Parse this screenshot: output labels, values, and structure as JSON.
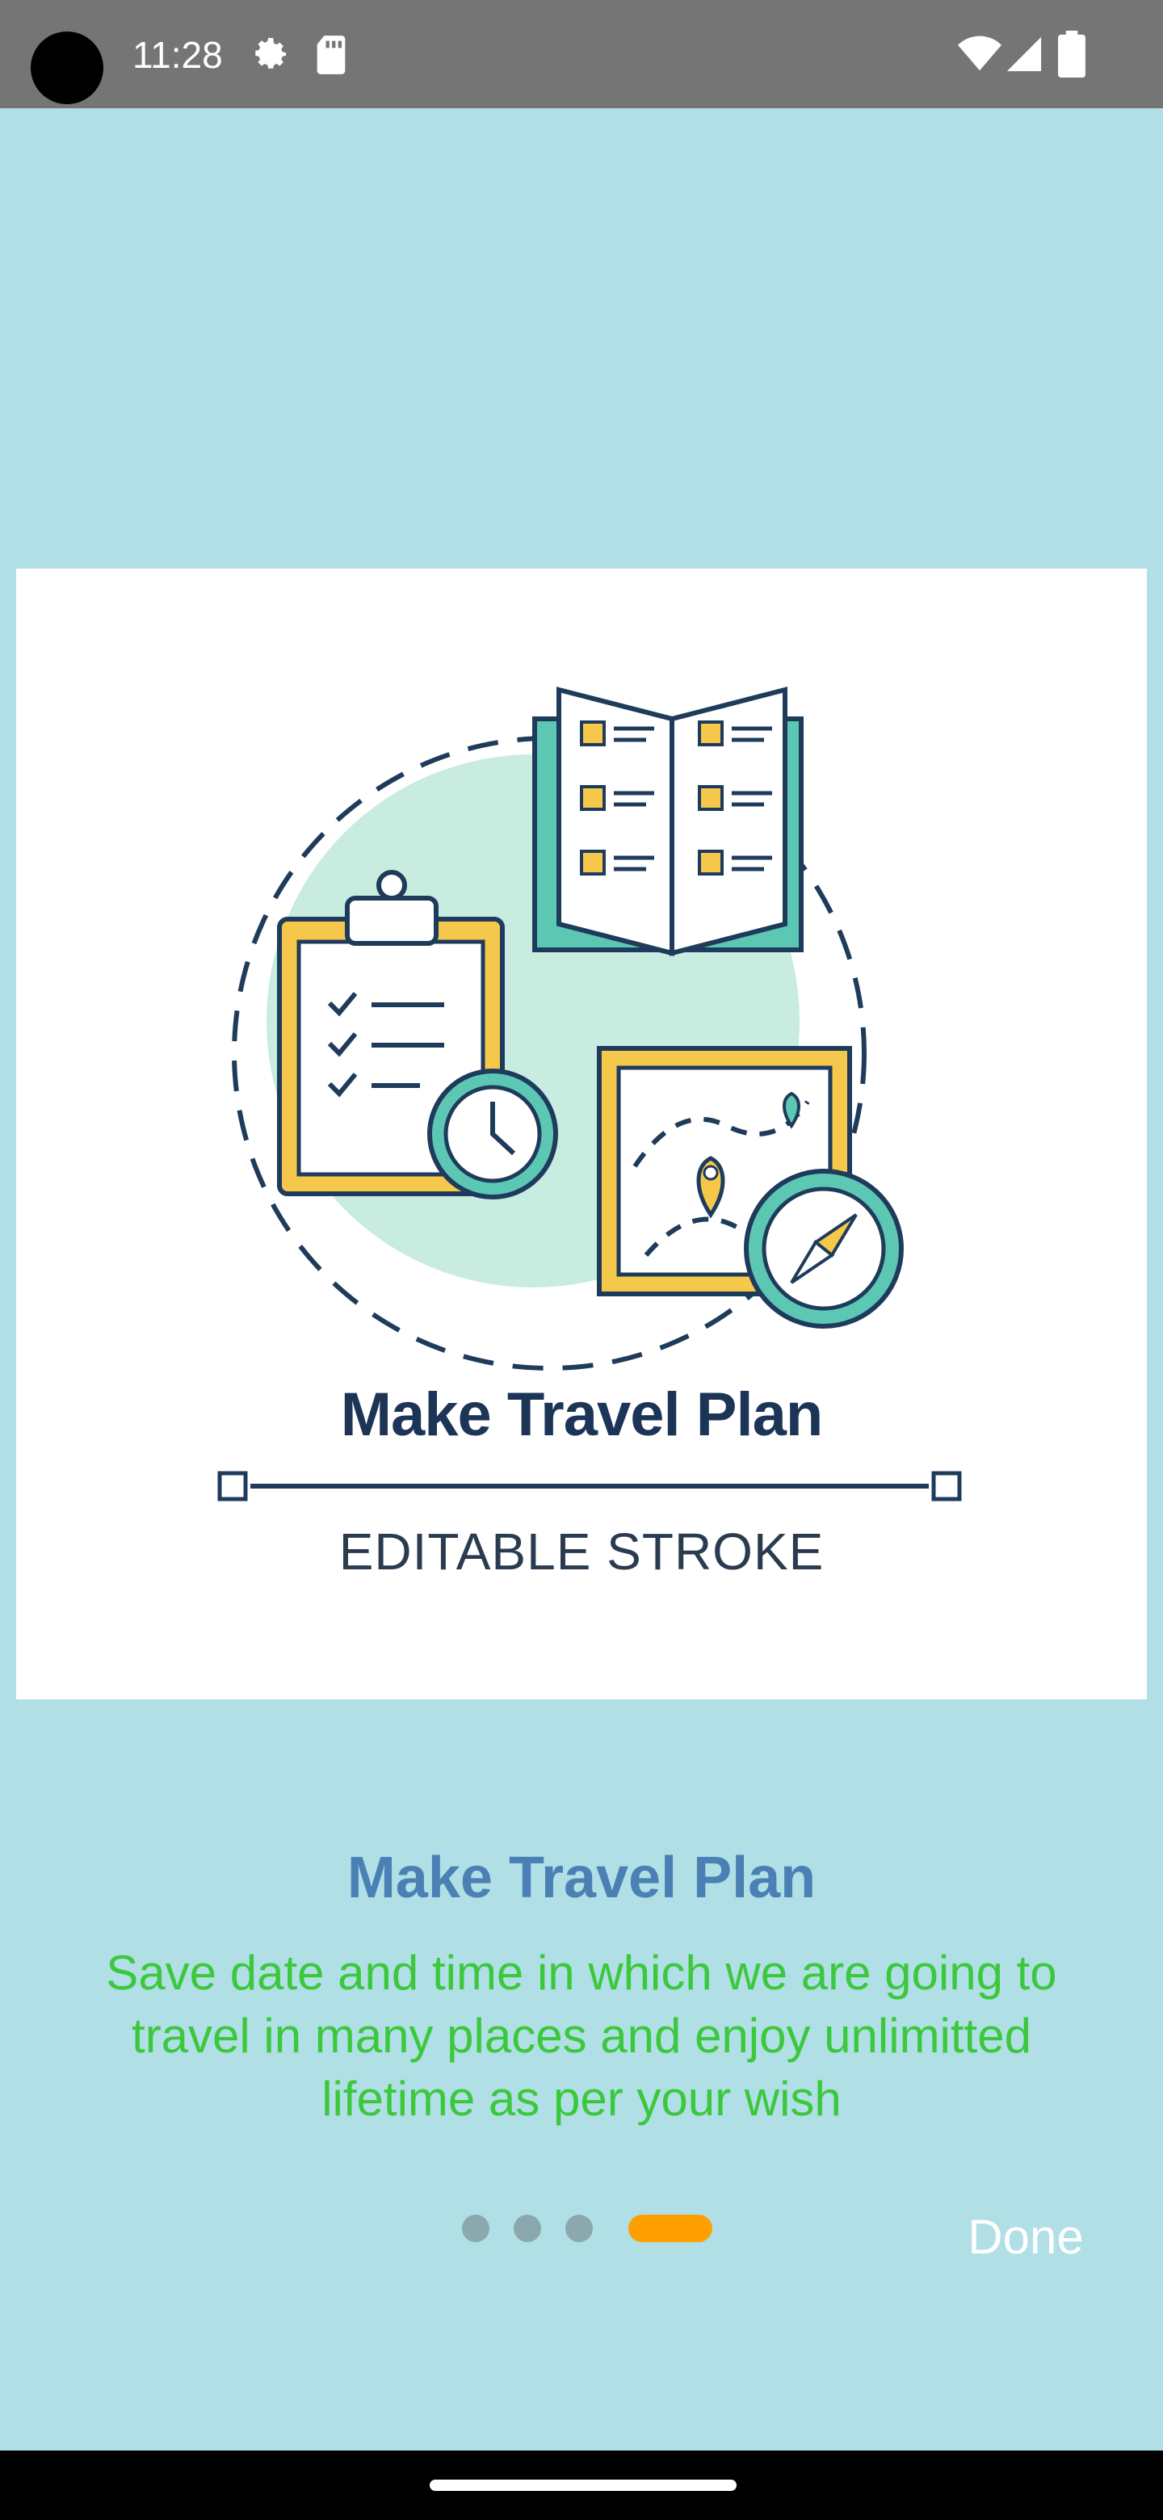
{
  "status_bar": {
    "time": "11:28",
    "icons": [
      "settings-gear-icon",
      "sd-card-icon",
      "wifi-icon",
      "cell-signal-icon",
      "battery-icon"
    ]
  },
  "hero": {
    "art_title": "Make Travel Plan",
    "art_subtitle": "EDITABLE STROKE",
    "icons": [
      "open-map-book-icon",
      "clipboard-checklist-icon",
      "clock-icon",
      "folded-map-icon",
      "location-pin-icon",
      "compass-icon"
    ]
  },
  "slide": {
    "title": "Make Travel Plan",
    "description": "Save date and time in which we are going to travel in many places and enjoy unlimitted lifetime as per your wish"
  },
  "pager": {
    "total": 4,
    "active_index": 3
  },
  "actions": {
    "done_label": "Done"
  },
  "colors": {
    "background": "#b0dfe5",
    "title": "#4a80b4",
    "description": "#3cc83c",
    "active_dot": "#ffa000",
    "inactive_dot": "#8aa8ad"
  }
}
